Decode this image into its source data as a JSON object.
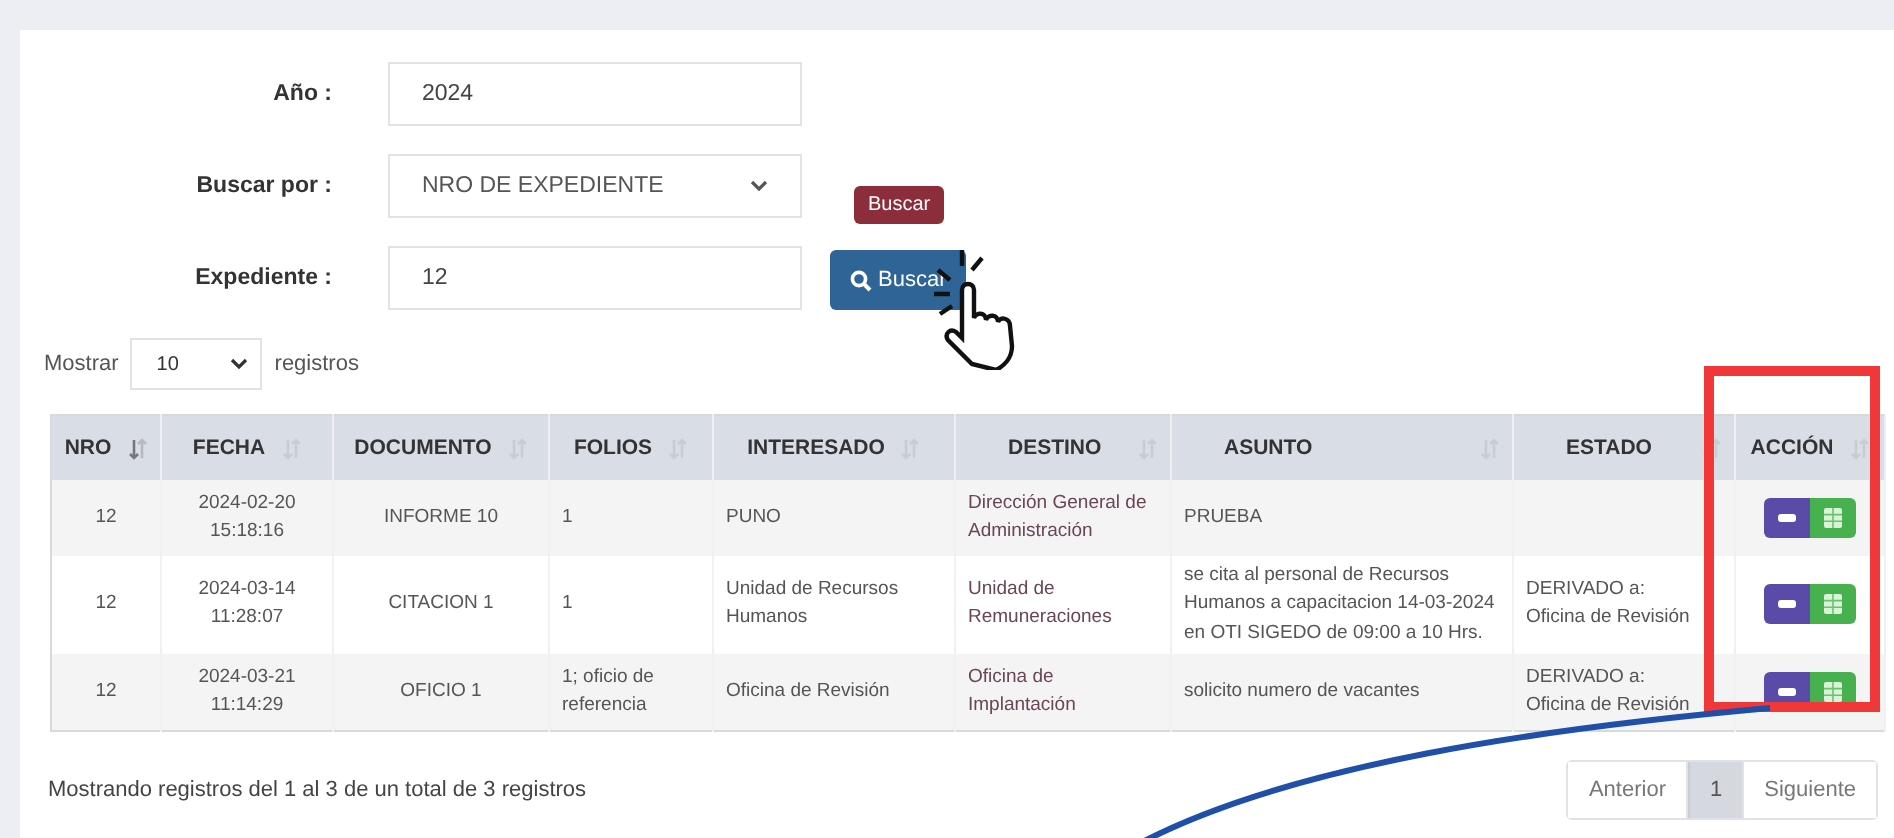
{
  "form": {
    "fields": [
      {
        "label": "Año :",
        "kind": "input",
        "value": "2024"
      },
      {
        "label": "Buscar por :",
        "kind": "select",
        "value": "NRO DE EXPEDIENTE"
      },
      {
        "label": "Expediente :",
        "kind": "input",
        "value": "12"
      }
    ],
    "search_button": {
      "label": "Buscar",
      "tooltip": "Buscar"
    }
  },
  "length_menu": {
    "prefix": "Mostrar",
    "value": "10",
    "suffix": "registros"
  },
  "table": {
    "columns": [
      {
        "label": "NRO",
        "sorted": true
      },
      {
        "label": "FECHA",
        "sorted": false
      },
      {
        "label": "DOCUMENTO",
        "sorted": false
      },
      {
        "label": "FOLIOS",
        "sorted": false
      },
      {
        "label": "INTERESADO",
        "sorted": false
      },
      {
        "label": "DESTINO",
        "sorted": false
      },
      {
        "label": "ASUNTO",
        "sorted": false
      },
      {
        "label": "ESTADO",
        "sorted": false
      },
      {
        "label": "ACCIÓN",
        "sorted": false
      }
    ],
    "rows": [
      {
        "cells": [
          "12",
          "2024-02-20 15:18:16",
          "INFORME 10",
          "1",
          "PUNO",
          "Dirección General de Administración",
          "PRUEBA",
          null
        ]
      },
      {
        "cells": [
          "12",
          "2024-03-14 11:28:07",
          "CITACION 1",
          "1",
          "Unidad de Recursos Humanos",
          "Unidad de Remuneraciones",
          "se cita al personal de Recursos Humanos a capacitacion 14-03-2024 en OTI SIGEDO de 09:00 a 10 Hrs.",
          "DERIVADO a: Oficina de Revisión"
        ]
      },
      {
        "cells": [
          "12",
          "2024-03-21 11:14:29",
          "OFICIO 1",
          "1; oficio de referencia",
          "Oficina de Revisión",
          "Oficina de Implantación",
          "solicito numero de vacantes",
          "DERIVADO a: Oficina de Revisión"
        ]
      }
    ]
  },
  "info": "Mostrando registros del 1 al 3 de un total de 3 registros",
  "pagination": [
    {
      "label": "Anterior",
      "selected": false
    },
    {
      "label": "1",
      "selected": true
    },
    {
      "label": "Siguiente",
      "selected": false
    }
  ]
}
